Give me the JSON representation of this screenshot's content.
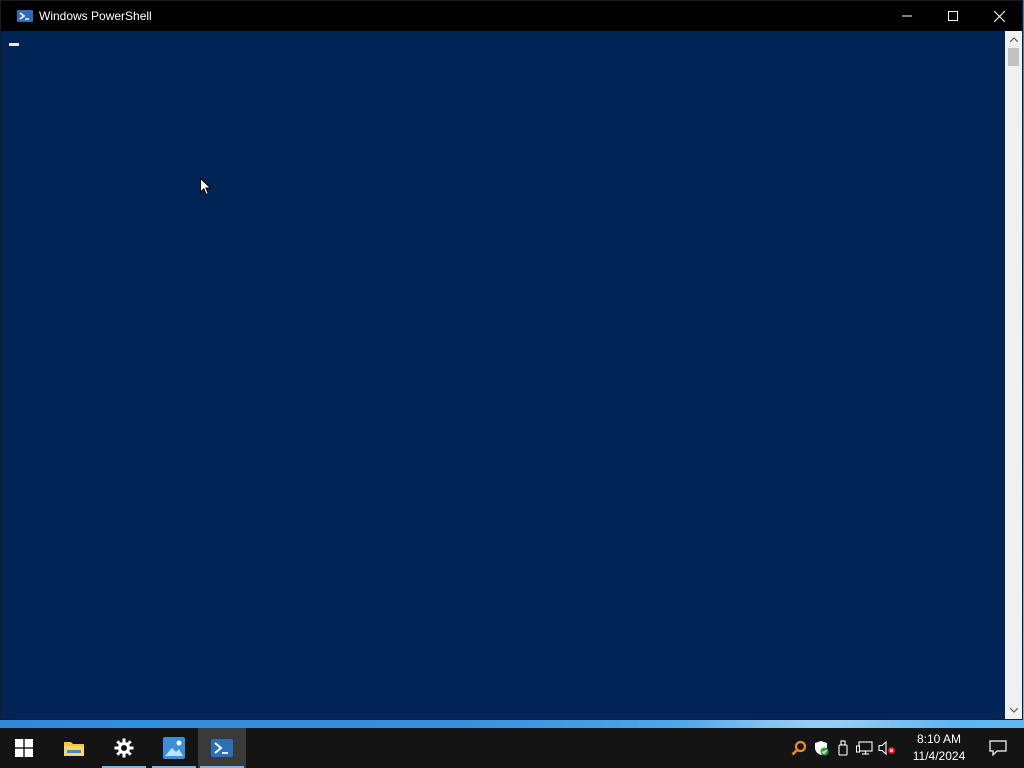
{
  "window": {
    "title": "Windows PowerShell",
    "icon": "powershell-icon",
    "controls": [
      "minimize-icon",
      "maximize-icon",
      "close-icon"
    ],
    "background_color": "#012456"
  },
  "console": {
    "text": ""
  },
  "taskbar": {
    "pinned": [
      {
        "name": "start-button",
        "icon": "windows-logo-icon"
      },
      {
        "name": "file-explorer",
        "icon": "folder-icon"
      },
      {
        "name": "settings",
        "icon": "gear-icon"
      },
      {
        "name": "photos",
        "icon": "photos-icon"
      },
      {
        "name": "powershell",
        "icon": "powershell-icon",
        "active": true
      }
    ],
    "tray_icons": [
      "search-tool-icon",
      "security-shield-icon",
      "usb-device-icon",
      "network-icon",
      "volume-muted-icon"
    ],
    "clock": {
      "time": "8:10 AM",
      "date": "11/4/2024"
    },
    "notification_icon": "action-center-icon"
  }
}
